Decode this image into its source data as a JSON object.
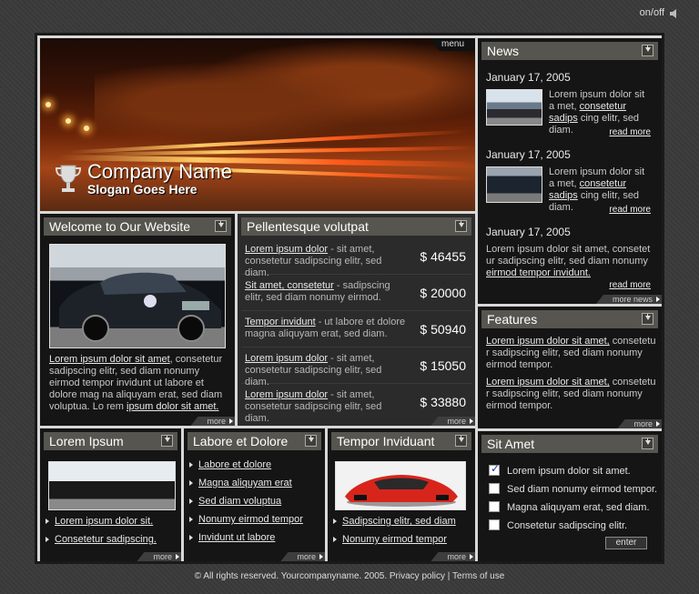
{
  "topbar": {
    "sound": "on/off"
  },
  "hero": {
    "menu": "menu",
    "company": "Company Name",
    "slogan": "Slogan Goes Here"
  },
  "welcome": {
    "title": "Welcome to Our Website",
    "link1": "Lorem ipsum dolor sit amet",
    "text1": ", consetetur sadipscing elitr, sed diam nonumy eirmod tempor invidunt ut labore et dolore mag na aliquyam erat, sed diam voluptua. Lo rem ",
    "link2": "ipsum dolor sit amet.",
    "more": "more"
  },
  "pellentesque": {
    "title": "Pellentesque volutpat",
    "rows": [
      {
        "link": "Lorem ipsum dolor",
        "text": " - sit amet, consetetur sadipscing elitr, sed diam.",
        "price": "$ 46455"
      },
      {
        "link": "Sit amet, consetetur",
        "text": " - sadipscing elitr, sed diam nonumy eirmod.",
        "price": "$ 20000"
      },
      {
        "link": "Tempor invidunt",
        "text": " - ut labore et dolore magna aliquyam erat, sed diam.",
        "price": "$ 50940"
      },
      {
        "link": "Lorem ipsum dolor",
        "text": " - sit amet, consetetur sadipscing elitr, sed diam.",
        "price": "$ 15050"
      },
      {
        "link": "Lorem ipsum dolor",
        "text": " - sit amet, consetetur sadipscing elitr, sed diam.",
        "price": "$ 33880"
      }
    ],
    "more": "more"
  },
  "news": {
    "title": "News",
    "items": [
      {
        "date": "January 17, 2005",
        "pre": "Lorem ipsum dolor sit a met, ",
        "link": "consetetur sadips",
        "post": " cing elitr, sed diam.",
        "readmore": "read more"
      },
      {
        "date": "January 17, 2005",
        "pre": "Lorem ipsum dolor sit a met, ",
        "link": "consetetur sadips",
        "post": " cing elitr, sed diam.",
        "readmore": "read more"
      },
      {
        "date": "January 17, 2005",
        "pre": "Lorem ipsum dolor sit amet, consetet ur sadipscing elitr, sed diam nonumy ",
        "link": "eirmod tempor invidunt.",
        "post": "",
        "readmore": "read more"
      }
    ],
    "more": "more news"
  },
  "features": {
    "title": "Features",
    "items": [
      {
        "link": "Lorem ipsum dolor sit amet,",
        "text": " consetetu r sadipscing elitr, sed diam nonumy eirmod tempor."
      },
      {
        "link": "Lorem ipsum dolor sit amet,",
        "text": " consetetu r sadipscing elitr, sed diam nonumy eirmod tempor."
      }
    ],
    "more": "more"
  },
  "lorem": {
    "title": "Lorem Ipsum",
    "links": [
      "Lorem ipsum dolor sit.",
      "Consetetur sadipscing."
    ],
    "more": "more"
  },
  "labore": {
    "title": "Labore et Dolore",
    "links": [
      "Labore et dolore",
      "Magna aliquyam erat",
      "Sed diam voluptua",
      "Nonumy eirmod tempor",
      "Invidunt ut labore"
    ],
    "more": "more"
  },
  "tempor": {
    "title": "Tempor Inviduant",
    "links": [
      "Sadipscing elitr, sed diam",
      "Nonumy eirmod tempor"
    ],
    "more": "more"
  },
  "sitamet": {
    "title": "Sit Amet",
    "checks": [
      {
        "label": "Lorem ipsum dolor sit amet.",
        "checked": true
      },
      {
        "label": "Sed diam nonumy eirmod tempor.",
        "checked": false
      },
      {
        "label": "Magna aliquyam erat, sed diam.",
        "checked": false
      },
      {
        "label": "Consetetur sadipscing elitr.",
        "checked": false
      }
    ],
    "enter": "enter"
  },
  "footer": {
    "copy": "© All rights reserved. Yourcompanyname. 2005. ",
    "privacy": "Privacy policy",
    "sep": " | ",
    "terms": "Terms of use"
  }
}
